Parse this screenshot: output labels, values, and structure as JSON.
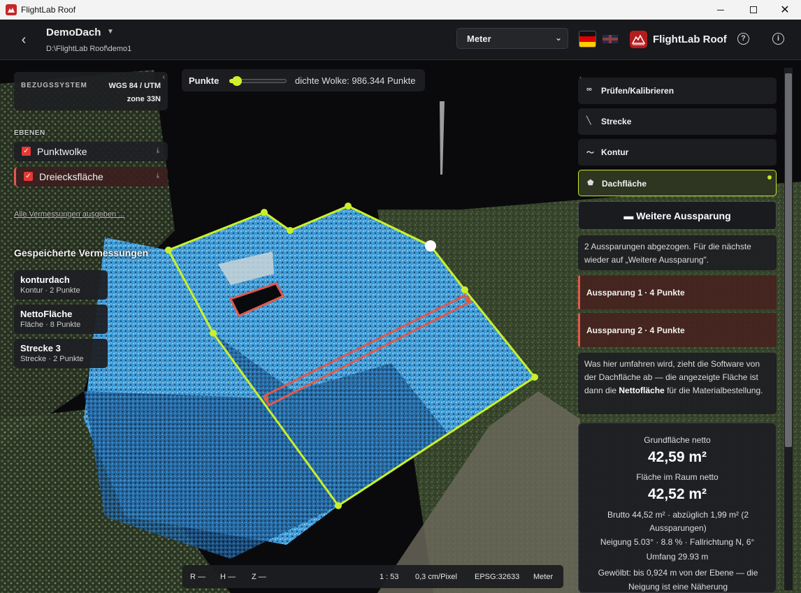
{
  "window": {
    "title": "FlightLab Roof"
  },
  "header": {
    "project_name": "DemoDach",
    "project_path": "D:\\FlightLab Roof\\demo1",
    "unit_selected": "Meter",
    "brand": "FlightLab Roof"
  },
  "bezug": {
    "label": "BEZUGSSYSTEM",
    "value_line1": "WGS 84 / UTM",
    "value_line2": "zone 33N"
  },
  "ebenen": {
    "label": "EBENEN",
    "layers": [
      {
        "label": "Punktwolke",
        "checked": true
      },
      {
        "label": "Dreiecksfläche",
        "checked": true
      }
    ],
    "export_link": "Alle Vermessungen ausgeben ..."
  },
  "saved": {
    "title": "Gespeicherte Vermessungen",
    "items": [
      {
        "name": "konturdach",
        "sub": "Kontur · 2 Punkte"
      },
      {
        "name": "NettoFläche",
        "sub": "Fläche · 8 Punkte"
      },
      {
        "name": "Strecke 3",
        "sub": "Strecke · 2 Punkte"
      }
    ]
  },
  "points": {
    "label": "Punkte",
    "info": "dichte Wolke: 986.344 Punkte"
  },
  "tools": [
    {
      "label": "Prüfen/Kalibrieren",
      "icon": "binoculars-icon"
    },
    {
      "label": "Strecke",
      "icon": "ruler-icon"
    },
    {
      "label": "Kontur",
      "icon": "wave-icon"
    },
    {
      "label": "Dachfläche",
      "icon": "pentagon-icon",
      "active": true
    }
  ],
  "aussparung_button": "Weitere Aussparung",
  "info1": "2 Aussparungen abgezogen. Für die nächste wieder auf „Weitere Aussparung\".",
  "aussparungen": [
    {
      "label": "Aussparung 1 · 4 Punkte"
    },
    {
      "label": "Aussparung 2 · 4 Punkte"
    }
  ],
  "info2": {
    "before": "Was hier umfahren wird, zieht die Software von der Dachfläche ab — die angezeigte Fläche ist dann die ",
    "bold": "Nettofläche",
    "after": " für die Materialbestellung."
  },
  "result": {
    "grund_label": "Grundfläche netto",
    "grund_value": "42,59 m²",
    "raum_label": "Fläche im Raum netto",
    "raum_value": "42,52 m²",
    "brutto": "Brutto 44,52 m² · abzüglich 1,99 m² (2 Aussparungen)",
    "neigung": "Neigung 5.03° · 8.8 % · Fallrichtung N, 6°",
    "umfang": "Umfang 29.93 m",
    "gewoelbt": "Gewölbt: bis 0,924 m von der Ebene — die Neigung ist eine Näherung"
  },
  "status": {
    "r": "R —",
    "h": "H —",
    "z": "Z —",
    "scale": "1 : 53",
    "resolution": "0,3 cm/Pixel",
    "epsg": "EPSG:32633",
    "unit": "Meter"
  },
  "colors": {
    "accent": "#c9e52a",
    "cutout": "#e05a4a",
    "brand": "#c62828"
  }
}
